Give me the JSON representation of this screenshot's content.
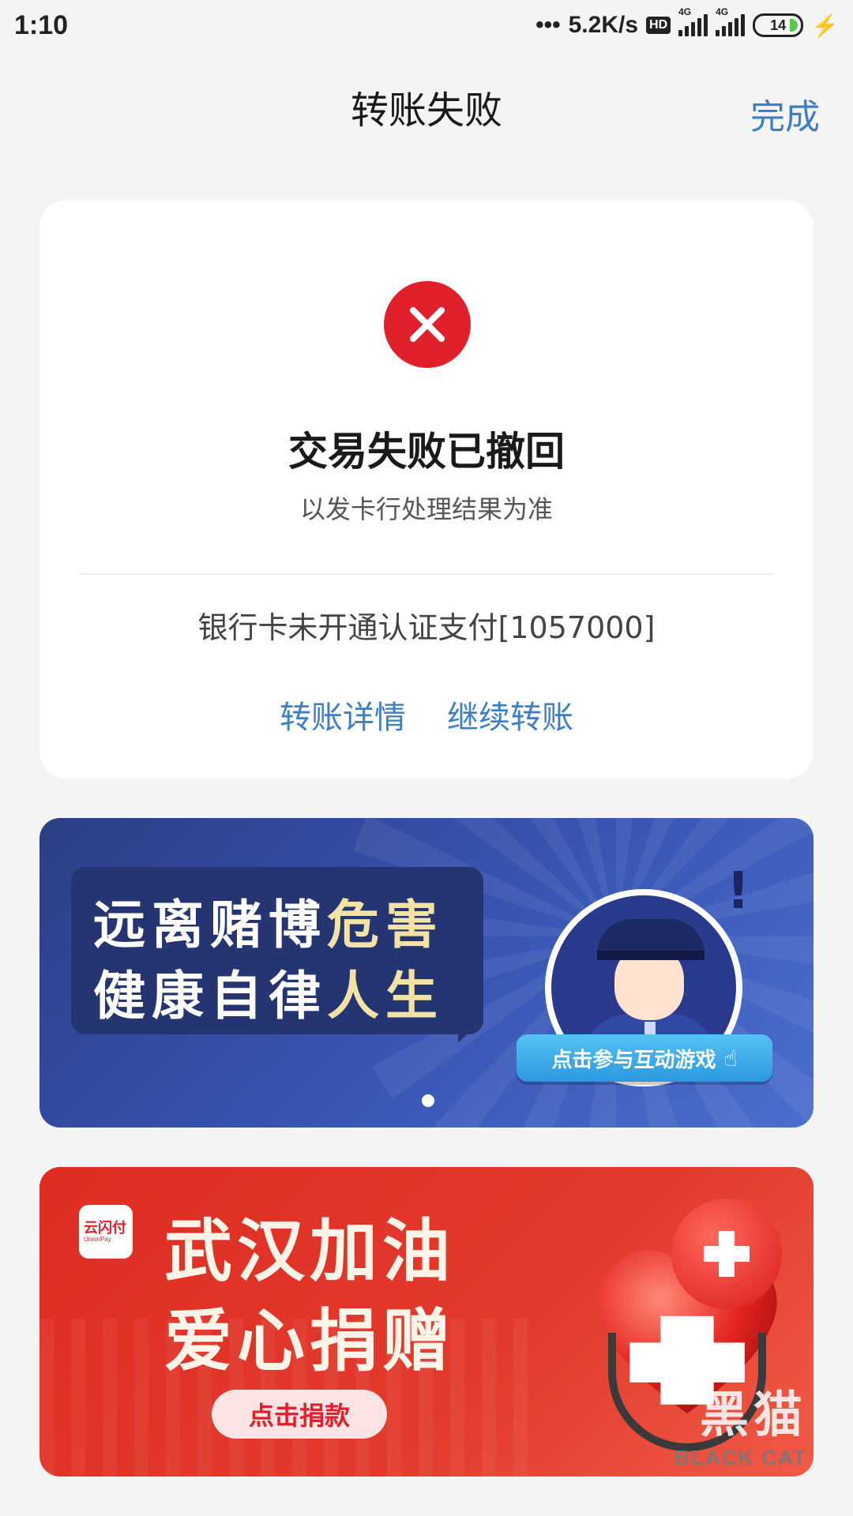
{
  "status_bar": {
    "time": "1:10",
    "network_speed": "5.2K/s",
    "hd_label": "HD",
    "signal1_label": "4G",
    "signal2_label": "4G",
    "battery_level": "14",
    "icons": [
      "dots-icon",
      "hd-icon",
      "signal-icon",
      "signal-icon",
      "battery-icon",
      "charging-icon"
    ]
  },
  "header": {
    "title": "转账失败",
    "done_label": "完成"
  },
  "result": {
    "icon": "error-x-icon",
    "title": "交易失败已撤回",
    "subtitle": "以发卡行处理结果为准",
    "error_message": "银行卡未开通认证支付[1057000]",
    "actions": {
      "details_label": "转账详情",
      "continue_label": "继续转账"
    }
  },
  "banner_gambling": {
    "line1_white": "远离赌博",
    "line1_gold": "危害",
    "line2_white": "健康自律",
    "line2_gold": "人生",
    "button_label": "点击参与互动游戏",
    "carousel_index": 1
  },
  "banner_wuhan": {
    "logo_text": "云闪付",
    "logo_sub": "UnionPay",
    "line1": "武汉加油",
    "line2": "爱心捐赠",
    "button_label": "点击捐款"
  },
  "watermark": {
    "main": "黑猫",
    "sub": "BLACK CAT"
  },
  "colors": {
    "accent_blue": "#3d7fc4",
    "error_red": "#e0202a",
    "background": "#f4f4f4"
  }
}
